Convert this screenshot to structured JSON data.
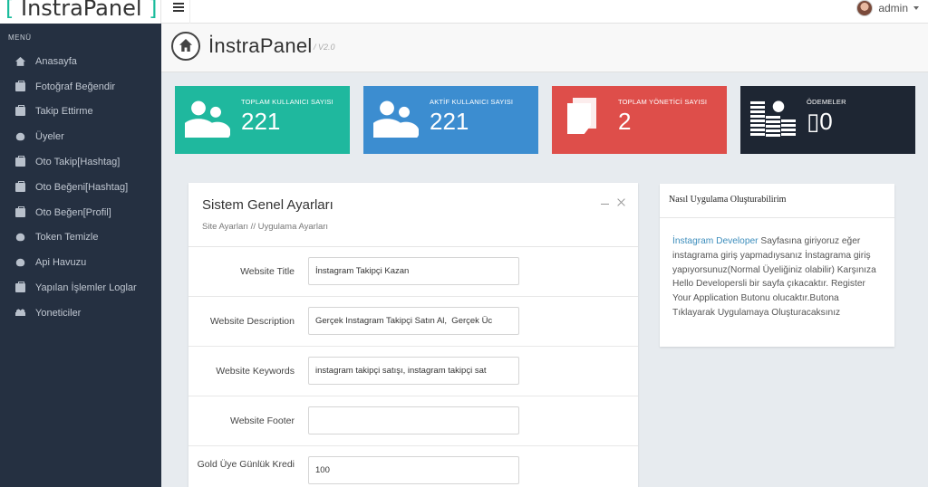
{
  "brand": {
    "bracket_open": "[",
    "name": " İnstraPanel ",
    "bracket_close": "]"
  },
  "topbar": {
    "menu_icon": "hamburger-icon",
    "user_name": "admin"
  },
  "sidebar": {
    "title": "MENÜ",
    "items": [
      {
        "label": "Anasayfa",
        "icon": "home-icon"
      },
      {
        "label": "Fotoğraf Beğendir",
        "icon": "briefcase-icon"
      },
      {
        "label": "Takip Ettirme",
        "icon": "briefcase-icon"
      },
      {
        "label": "Üyeler",
        "icon": "bug-icon"
      },
      {
        "label": "Oto Takip[Hashtag]",
        "icon": "briefcase-icon"
      },
      {
        "label": "Oto Beğeni[Hashtag]",
        "icon": "briefcase-icon"
      },
      {
        "label": "Oto Beğen[Profil]",
        "icon": "briefcase-icon"
      },
      {
        "label": "Token Temizle",
        "icon": "bug-icon"
      },
      {
        "label": "Api Havuzu",
        "icon": "bug-icon"
      },
      {
        "label": "Yapılan İşlemler Loglar",
        "icon": "briefcase-icon"
      },
      {
        "label": "Yoneticiler",
        "icon": "users-icon"
      }
    ]
  },
  "header": {
    "title": "İnstraPanel",
    "version": "/ V2.0"
  },
  "stats": [
    {
      "label": "TOPLAM KULLANICI SAYISI",
      "value": "221",
      "color": "#1fb89e",
      "icon": "users-icon"
    },
    {
      "label": "AKTİF KULLANICI SAYISI",
      "value": "221",
      "color": "#3c8dd0",
      "icon": "users-icon"
    },
    {
      "label": "TOPLAM YÖNETİCİ SAYISI",
      "value": "2",
      "color": "#de4e4a",
      "icon": "documents-icon"
    },
    {
      "label": "ÖDEMELER",
      "value": "▯0",
      "color": "#1e2633",
      "icon": "money-icon"
    }
  ],
  "settings": {
    "title": "Sistem Genel Ayarları",
    "breadcrumb": "Site Ayarları // Uygulama Ayarları",
    "fields": [
      {
        "label": "Website Title",
        "value": "İnstagram Takipçi Kazan"
      },
      {
        "label": "Website Description",
        "value": "Gerçek Instagram Takipçi Satın Al,  Gerçek Üc"
      },
      {
        "label": "Website Keywords",
        "value": "instagram takipçi satışı, instagram takipçi sat"
      },
      {
        "label": "Website Footer",
        "value": ""
      },
      {
        "label": "Gold Üye Günlük Kredi",
        "value": "100"
      }
    ]
  },
  "info": {
    "title": "Nasıl Uygulama Oluşturabilirim",
    "link_text": "İnstagram Developer",
    "body": " Sayfasına giriyoruz eğer instagrama giriş yapmadıysanız İnstagrama giriş yapıyorsunuz(Normal Üyeliğiniz olabilir) Karşınıza Hello Developersli bir sayfa çıkacaktır. Register Your Application Butonu olucaktır.Butona Tıklayarak Uygulamaya Oluşturacaksınız"
  }
}
